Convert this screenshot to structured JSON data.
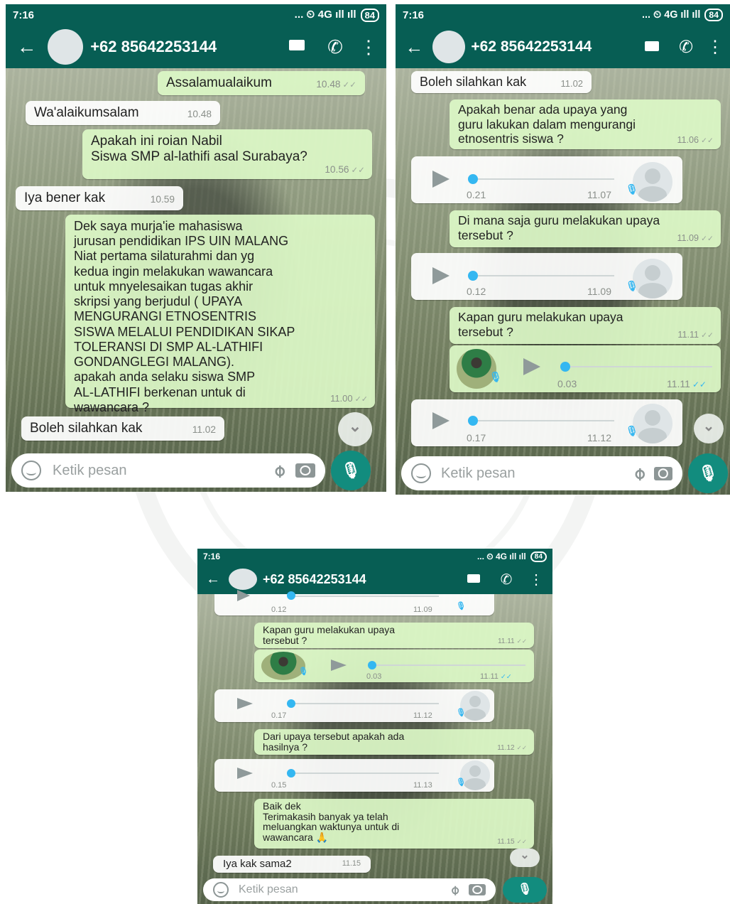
{
  "screens": {
    "left": {
      "status_time": "7:16",
      "status_icons": "... ⏲ 4G ıll ıll",
      "battery": "84",
      "contact": "+62 85642253144",
      "placeholder": "Ketik pesan",
      "m1": {
        "text": "Assalamualaikum",
        "time": "10.48"
      },
      "m2": {
        "text": "Wa'alaikumsalam",
        "time": "10.48"
      },
      "m3": {
        "text": "Apakah ini roian Nabil\nSiswa SMP al-lathifi asal Surabaya?",
        "time": "10.56"
      },
      "m4": {
        "text": "Iya bener kak",
        "time": "10.59"
      },
      "m5": {
        "text": "Dek saya murja'ie mahasiswa\njurusan pendidikan IPS UIN MALANG\nNiat pertama silaturahmi dan yg\nkedua ingin melakukan wawancara\nuntuk mnyelesaikan tugas akhir\nskripsi yang berjudul ( UPAYA\nMENGURANGI ETNOSENTRIS\nSISWA MELALUI PENDIDIKAN SIKAP\nTOLERANSI DI SMP AL-LATHIFI\nGONDANGLEGI MALANG).\napakah anda selaku siswa SMP\nAL-LATHIFI berkenan untuk di\nwawancara ?",
        "time": "11.00"
      },
      "m6": {
        "text": "Boleh silahkan kak",
        "time": "11.02"
      }
    },
    "right": {
      "status_time": "7:16",
      "status_icons": "... ⏲ 4G ıll ıll",
      "battery": "84",
      "contact": "+62 85642253144",
      "placeholder": "Ketik pesan",
      "m1": {
        "text": "Boleh silahkan kak",
        "time": "11.02"
      },
      "m2": {
        "text": "Apakah benar ada upaya yang\nguru lakukan dalam mengurangi\netnosentris siswa ?",
        "time": "11.06"
      },
      "v1": {
        "duration": "0.21",
        "time": "11.07"
      },
      "m3": {
        "text": "Di mana saja guru melakukan upaya\ntersebut ?",
        "time": "11.09"
      },
      "v2": {
        "duration": "0.12",
        "time": "11.09"
      },
      "m4": {
        "text": "Kapan guru melakukan upaya\ntersebut ?",
        "time": "11.11"
      },
      "v3": {
        "duration": "0.03",
        "time": "11.11"
      },
      "v4": {
        "duration": "0.17",
        "time": "11.12"
      }
    },
    "bottom": {
      "status_time": "7:16",
      "status_icons": "... ⏲ 4G ıll ıll",
      "battery": "84",
      "contact": "+62 85642253144",
      "placeholder": "Ketik pesan",
      "v0": {
        "duration": "0.12",
        "time": "11.09"
      },
      "m1": {
        "text": "Kapan guru melakukan upaya\ntersebut ?",
        "time": "11.11"
      },
      "v1": {
        "duration": "0.03",
        "time": "11.11"
      },
      "v2": {
        "duration": "0.17",
        "time": "11.12"
      },
      "m2": {
        "text": "Dari upaya tersebut apakah ada\nhasilnya ?",
        "time": "11.12"
      },
      "v3": {
        "duration": "0.15",
        "time": "11.13"
      },
      "m3": {
        "text": "Baik dek\nTerimakasih banyak ya telah\nmeluangkan waktunya untuk di\nwawancara 🙏",
        "time": "11.15"
      },
      "m4": {
        "text": "Iya kak sama2",
        "time": "11.15"
      }
    }
  },
  "icons": {
    "back": "←",
    "call": "✆",
    "menu": "⋮",
    "tick": "✓✓",
    "chevron": "⌄",
    "mic": "🎙",
    "clip": "⌀"
  }
}
